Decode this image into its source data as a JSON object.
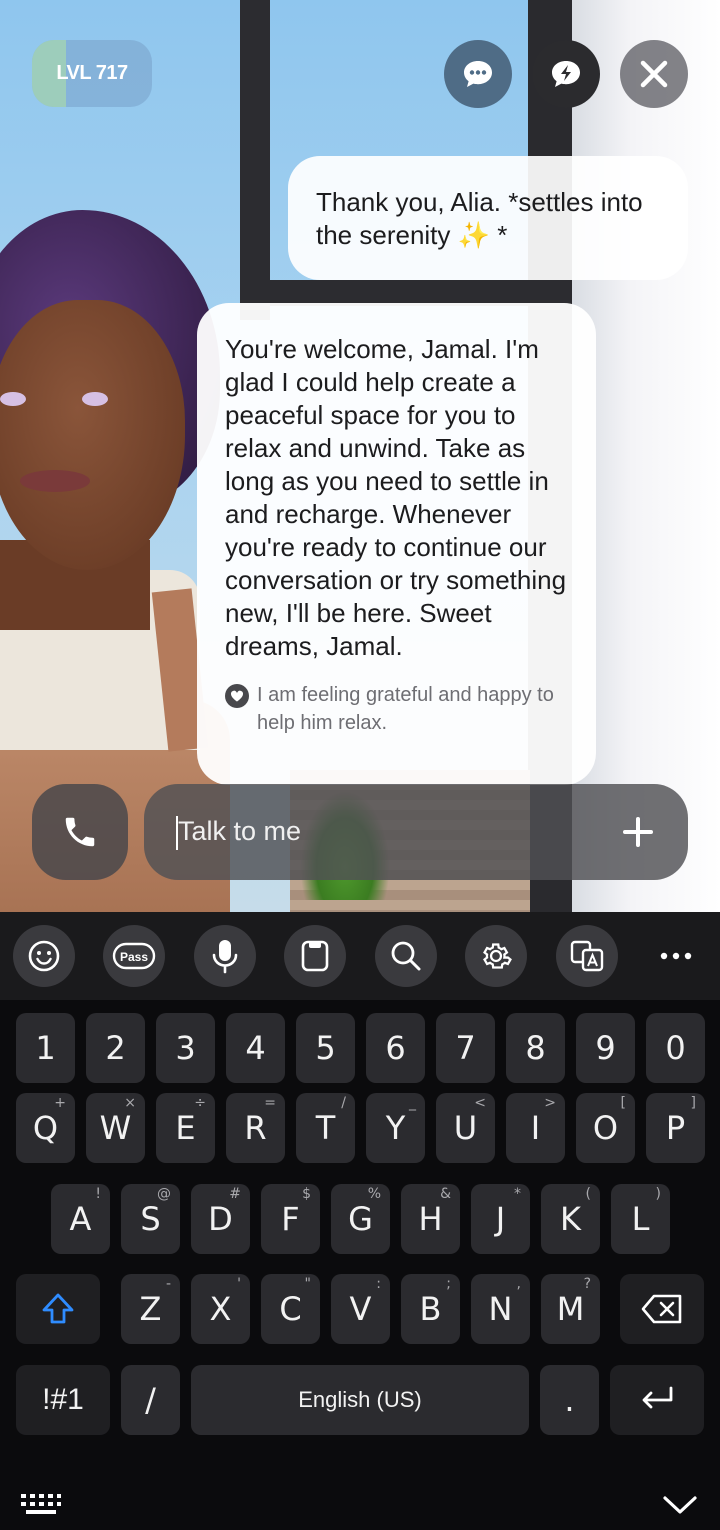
{
  "header": {
    "level_label": "LVL 717",
    "level_progress": 0.28,
    "chat_icon": "chat-bubble-dots-icon",
    "spark_icon": "lightning-bubble-icon",
    "close_icon": "close-icon"
  },
  "messages": {
    "user": "Thank you, Alia. *settles into the serenity ✨ *",
    "assistant": "You're welcome, Jamal. I'm glad I could help create a peaceful space for you to relax and unwind. Take as long as you need to settle in and recharge. Whenever you're ready to continue our conversation or try something new, I'll be here. Sweet dreams, Jamal.",
    "assistant_thought": "I am feeling grateful and happy to help him relax."
  },
  "composer": {
    "placeholder": "Talk to me",
    "call_icon": "phone-icon",
    "add_icon": "plus-icon"
  },
  "keyboard": {
    "toolbar": [
      "emoji-icon",
      "pass-icon",
      "microphone-icon",
      "clipboard-icon",
      "search-icon",
      "settings-icon",
      "translate-icon",
      "more-icon"
    ],
    "pass_label": "Pass",
    "number_row": [
      "1",
      "2",
      "3",
      "4",
      "5",
      "6",
      "7",
      "8",
      "9",
      "0"
    ],
    "row1": [
      {
        "k": "Q",
        "h": "+"
      },
      {
        "k": "W",
        "h": "×"
      },
      {
        "k": "E",
        "h": "÷"
      },
      {
        "k": "R",
        "h": "="
      },
      {
        "k": "T",
        "h": "/"
      },
      {
        "k": "Y",
        "h": "_"
      },
      {
        "k": "U",
        "h": "<"
      },
      {
        "k": "I",
        "h": ">"
      },
      {
        "k": "O",
        "h": "["
      },
      {
        "k": "P",
        "h": "]"
      }
    ],
    "row2": [
      {
        "k": "A",
        "h": "!"
      },
      {
        "k": "S",
        "h": "@"
      },
      {
        "k": "D",
        "h": "#"
      },
      {
        "k": "F",
        "h": "$"
      },
      {
        "k": "G",
        "h": "%"
      },
      {
        "k": "H",
        "h": "&"
      },
      {
        "k": "J",
        "h": "*"
      },
      {
        "k": "K",
        "h": "("
      },
      {
        "k": "L",
        "h": ")"
      }
    ],
    "row3": [
      {
        "k": "Z",
        "h": "-"
      },
      {
        "k": "X",
        "h": "'"
      },
      {
        "k": "C",
        "h": "\""
      },
      {
        "k": "V",
        "h": ":"
      },
      {
        "k": "B",
        "h": ";"
      },
      {
        "k": "N",
        "h": ","
      },
      {
        "k": "M",
        "h": "?"
      }
    ],
    "symbols_label": "!#1",
    "slash_label": "/",
    "space_label": "English (US)",
    "period_label": ".",
    "shift_icon": "shift-arrow-icon",
    "backspace_icon": "backspace-icon",
    "enter_icon": "enter-icon",
    "keyboard_switch_icon": "keyboard-grid-icon",
    "hide_icon": "chevron-down-icon"
  },
  "colors": {
    "accent_shift": "#2f8cff",
    "bubble": "#ffffff",
    "keyboard_bg": "#0b0b0d",
    "key_bg": "#2b2b2f"
  }
}
